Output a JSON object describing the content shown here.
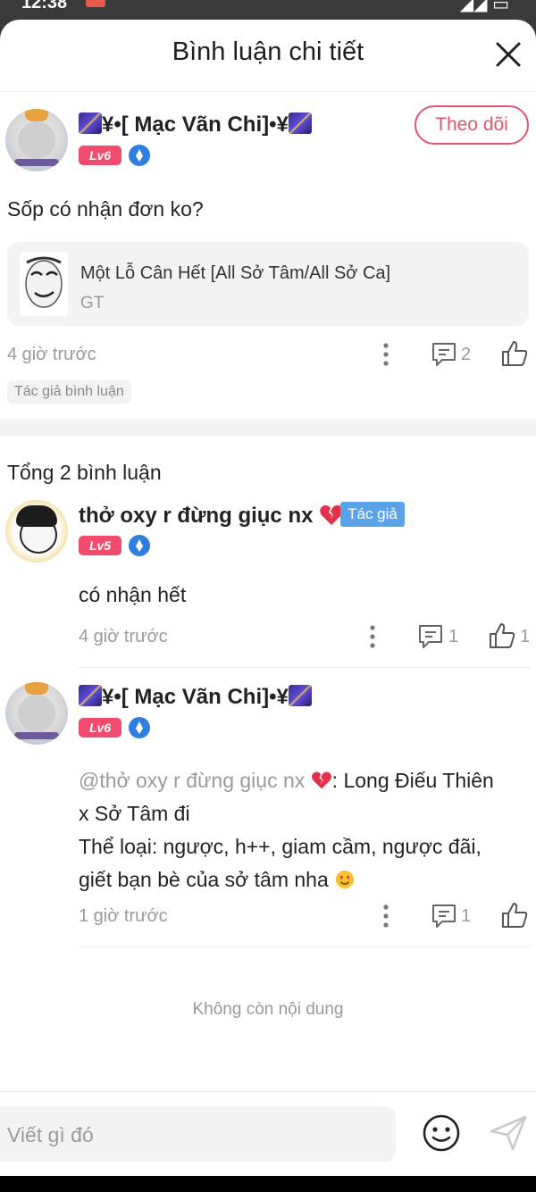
{
  "status": {
    "time": "12:38",
    "right": "◢◢ ▭"
  },
  "header": {
    "title": "Bình luận chi tiết"
  },
  "main_comment": {
    "username": "¥•[ Mạc Vãn Chi]•¥",
    "level": "Lv6",
    "follow_label": "Theo dõi",
    "text": "Sốp có nhận đơn ko?",
    "work": {
      "title": "Một Lỗ Cân Hết [All Sở Tâm/All Sở Ca]",
      "tag": "GT"
    },
    "time": "4 giờ trước",
    "reply_count": "2",
    "author_chip": "Tác giả bình luận"
  },
  "replies_header": {
    "total": "Tổng 2 bình luận"
  },
  "replies": [
    {
      "username": "thở oxy r đừng giục nx",
      "level": "Lv5",
      "author_badge": "Tác giả",
      "text": "có nhận hết",
      "time": "4 giờ trước",
      "reply_count": "1",
      "like_count": "1"
    },
    {
      "username": "¥•[ Mạc Vãn Chi]•¥",
      "level": "Lv6",
      "mention": "@thở oxy r đừng giục nx",
      "text_line1_rest": ": Long Điếu Thiên",
      "text_line2": "x Sở Tâm đi",
      "text_line3": "Thể loại: ngược, h++, giam cầm, ngược đãi,",
      "text_line4": "giết bạn bè của sở tâm nha",
      "time": "1 giờ trước",
      "reply_count": "1"
    }
  ],
  "footer": {
    "no_more": "Không còn nội dung"
  },
  "composer": {
    "placeholder": "Viết gì đó"
  }
}
